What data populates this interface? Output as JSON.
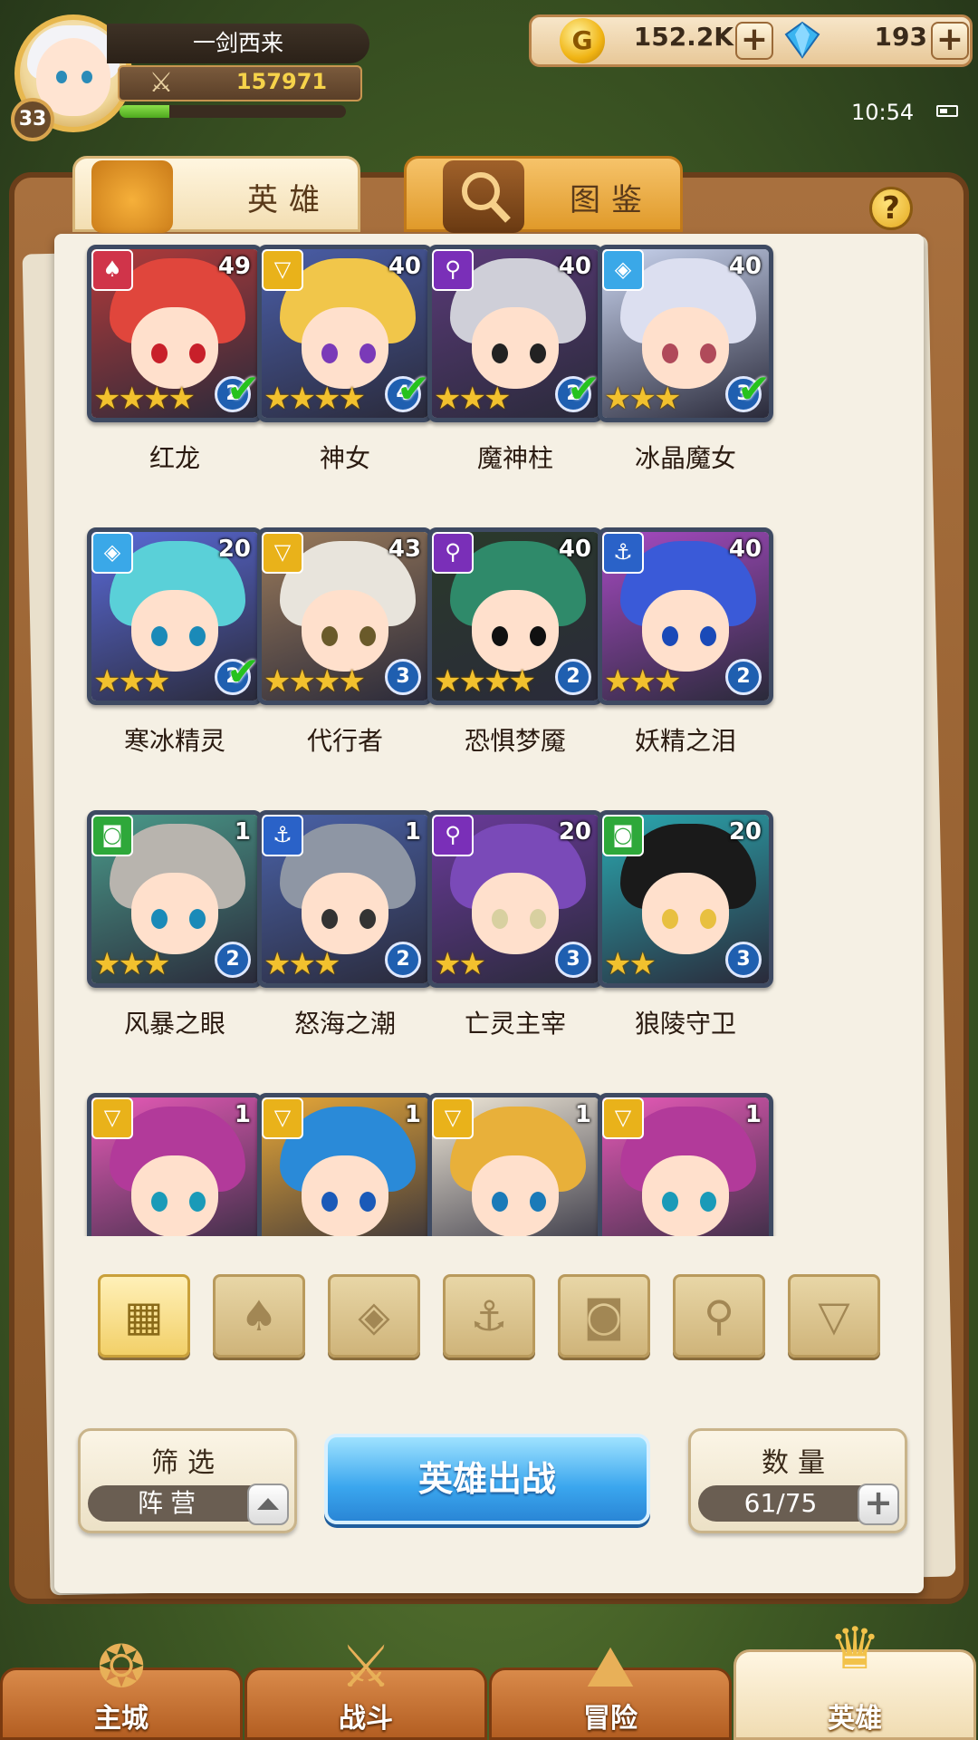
{
  "player": {
    "name": "一剑西来",
    "level": "33",
    "power": "157971",
    "exp_fraction": 0.22
  },
  "resources": {
    "gold": "152.2K",
    "gold_icon": "G",
    "gems": "193",
    "plus": "+"
  },
  "status": {
    "time": "10:54"
  },
  "tabs": [
    {
      "label": "英雄"
    },
    {
      "label": "图鉴"
    }
  ],
  "help": "?",
  "heroes": [
    {
      "name": "红龙",
      "level": "49",
      "grade": "2",
      "stars": 4,
      "owned_check": true,
      "faction": "fire",
      "faction_glyph": "♠",
      "faction_color": "#d0344a",
      "bg": "#b23a3a",
      "hair": "#e0463c",
      "eye": "#c8202a"
    },
    {
      "name": "神女",
      "level": "40",
      "grade": "4",
      "stars": 4,
      "owned_check": true,
      "faction": "light",
      "faction_glyph": "▽",
      "faction_color": "#e9b21a",
      "bg": "#4a5ea8",
      "hair": "#f1c64a",
      "eye": "#7a3ab8"
    },
    {
      "name": "魔神柱",
      "level": "40",
      "grade": "2",
      "stars": 3,
      "owned_check": true,
      "faction": "dark",
      "faction_glyph": "⚲",
      "faction_color": "#7a2fb8",
      "bg": "#5a3a78",
      "hair": "#cfcfd8",
      "eye": "#222222"
    },
    {
      "name": "冰晶魔女",
      "level": "40",
      "grade": "3",
      "stars": 3,
      "owned_check": true,
      "faction": "ice",
      "faction_glyph": "◈",
      "faction_color": "#3aa8e8",
      "bg": "#c9d4ef",
      "hair": "#dcdff0",
      "eye": "#b04a5a"
    },
    {
      "name": "寒冰精灵",
      "level": "20",
      "grade": "2",
      "stars": 3,
      "owned_check": true,
      "faction": "ice",
      "faction_glyph": "◈",
      "faction_color": "#3aa8e8",
      "bg": "#5a6ad8",
      "hair": "#5ad0d8",
      "eye": "#1a8ab8"
    },
    {
      "name": "代行者",
      "level": "43",
      "grade": "3",
      "stars": 4,
      "owned_check": false,
      "faction": "light",
      "faction_glyph": "▽",
      "faction_color": "#e9b21a",
      "bg": "#9a7a5a",
      "hair": "#e8e4dc",
      "eye": "#6a5a2a"
    },
    {
      "name": "恐惧梦魇",
      "level": "40",
      "grade": "2",
      "stars": 4,
      "owned_check": false,
      "faction": "dark",
      "faction_glyph": "⚲",
      "faction_color": "#7a2fb8",
      "bg": "#2a3a2a",
      "hair": "#2f8a6a",
      "eye": "#101010"
    },
    {
      "name": "妖精之泪",
      "level": "40",
      "grade": "2",
      "stars": 3,
      "owned_check": false,
      "faction": "water",
      "faction_glyph": "⚓",
      "faction_color": "#2a62c8",
      "bg": "#a64ac2",
      "hair": "#3a5ad8",
      "eye": "#1a4ab8"
    },
    {
      "name": "风暴之眼",
      "level": "1",
      "grade": "2",
      "stars": 3,
      "owned_check": false,
      "faction": "beast",
      "faction_glyph": "◙",
      "faction_color": "#2ea83a",
      "bg": "#4a9a8a",
      "hair": "#b8b4ae",
      "eye": "#1a8ab8"
    },
    {
      "name": "怒海之潮",
      "level": "1",
      "grade": "2",
      "stars": 3,
      "owned_check": false,
      "faction": "water",
      "faction_glyph": "⚓",
      "faction_color": "#2a62c8",
      "bg": "#4a62a8",
      "hair": "#8e96a4",
      "eye": "#333333"
    },
    {
      "name": "亡灵主宰",
      "level": "20",
      "grade": "3",
      "stars": 2,
      "owned_check": false,
      "faction": "dark",
      "faction_glyph": "⚲",
      "faction_color": "#7a2fb8",
      "bg": "#6a3a9a",
      "hair": "#7a4ab8",
      "eye": "#d8d0a0"
    },
    {
      "name": "狼陵守卫",
      "level": "20",
      "grade": "3",
      "stars": 2,
      "owned_check": false,
      "faction": "beast",
      "faction_glyph": "◙",
      "faction_color": "#2ea83a",
      "bg": "#2aa8b0",
      "hair": "#1a1a1a",
      "eye": "#e8c040"
    },
    {
      "name": "",
      "level": "1",
      "grade": "",
      "stars": 0,
      "owned_check": false,
      "faction": "light",
      "faction_glyph": "▽",
      "faction_color": "#e9b21a",
      "bg": "#e85ab8",
      "hair": "#b23a9a",
      "eye": "#1a9ab8"
    },
    {
      "name": "",
      "level": "1",
      "grade": "",
      "stars": 0,
      "owned_check": false,
      "faction": "light",
      "faction_glyph": "▽",
      "faction_color": "#e9b21a",
      "bg": "#e8a838",
      "hair": "#2a8ad8",
      "eye": "#1a5ab8"
    },
    {
      "name": "",
      "level": "1",
      "grade": "",
      "stars": 0,
      "owned_check": false,
      "faction": "light",
      "faction_glyph": "▽",
      "faction_color": "#e9b21a",
      "bg": "#f0e8d8",
      "hair": "#e8b03a",
      "eye": "#1a7ab8"
    },
    {
      "name": "",
      "level": "1",
      "grade": "",
      "stars": 0,
      "owned_check": false,
      "faction": "light",
      "faction_glyph": "▽",
      "faction_color": "#e9b21a",
      "bg": "#e85ab8",
      "hair": "#b23a9a",
      "eye": "#1a9ab8"
    }
  ],
  "faction_filters": [
    {
      "id": "all",
      "glyph": "▦",
      "active": true
    },
    {
      "id": "fire",
      "glyph": "♠",
      "active": false
    },
    {
      "id": "ice",
      "glyph": "◈",
      "active": false
    },
    {
      "id": "water",
      "glyph": "⚓",
      "active": false
    },
    {
      "id": "beast",
      "glyph": "◙",
      "active": false
    },
    {
      "id": "dark",
      "glyph": "⚲",
      "active": false
    },
    {
      "id": "light",
      "glyph": "▽",
      "active": false
    }
  ],
  "controls": {
    "filter_label": "筛选",
    "filter_value": "阵营",
    "deploy_label": "英雄出战",
    "count_label": "数量",
    "count_value": "61/75"
  },
  "nav": [
    {
      "label": "主城",
      "icon": "city-icon",
      "glyph": "❂",
      "active": false
    },
    {
      "label": "战斗",
      "icon": "crossed-swords-icon",
      "glyph": "⚔",
      "active": false
    },
    {
      "label": "冒险",
      "icon": "map-icon",
      "glyph": "⛰",
      "active": false
    },
    {
      "label": "英雄",
      "icon": "helmet-icon",
      "glyph": "♛",
      "active": true
    }
  ]
}
